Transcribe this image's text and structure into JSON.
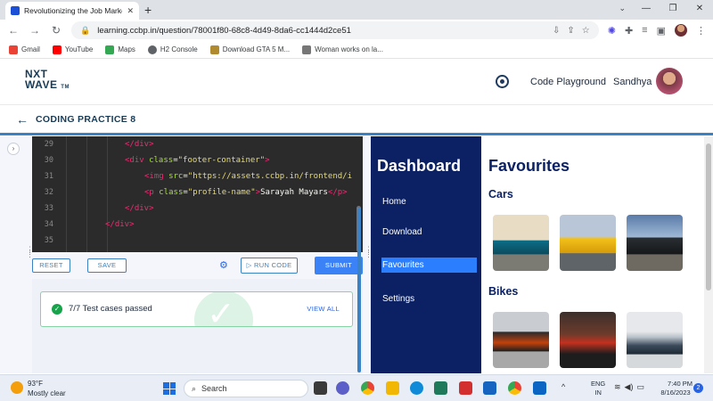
{
  "browser": {
    "tab_title": "Revolutionizing the Job Market | N",
    "url": "learning.ccbp.in/question/78001f80-68c8-4d49-8da6-cc1444d2ce51",
    "bookmarks": [
      {
        "label": "Gmail",
        "color": "#ea4335"
      },
      {
        "label": "YouTube",
        "color": "#ff0000"
      },
      {
        "label": "Maps",
        "color": "#34a853"
      },
      {
        "label": "H2 Console",
        "color": "#5f6368"
      },
      {
        "label": "Download GTA 5 M...",
        "color": "#b08a2e"
      },
      {
        "label": "Woman works on la...",
        "color": "#777777"
      }
    ]
  },
  "header": {
    "logo_line1": "NXT",
    "logo_line2": "WAVE",
    "logo_tm": "TM",
    "playground_label": "Code Playground",
    "username": "Sandhya"
  },
  "subheader": {
    "title": "CODING PRACTICE 8"
  },
  "editor": {
    "lines": [
      {
        "num": "29",
        "indent": 2,
        "tokens": [
          {
            "t": "tag",
            "v": "</div>"
          }
        ]
      },
      {
        "num": "30",
        "indent": 2,
        "tokens": [
          {
            "t": "tag",
            "v": "<div "
          },
          {
            "t": "attr",
            "v": "class"
          },
          {
            "t": "plain",
            "v": "="
          },
          {
            "t": "str",
            "v": "\"footer-container\""
          },
          {
            "t": "tag",
            "v": ">"
          }
        ]
      },
      {
        "num": "31",
        "indent": 3,
        "tokens": [
          {
            "t": "tag",
            "v": "<img "
          },
          {
            "t": "attr",
            "v": "src"
          },
          {
            "t": "plain",
            "v": "="
          },
          {
            "t": "str",
            "v": "\"https://assets.ccbp.in/frontend/i"
          }
        ]
      },
      {
        "num": "32",
        "indent": 3,
        "tokens": [
          {
            "t": "tag",
            "v": "<p "
          },
          {
            "t": "attr",
            "v": "class"
          },
          {
            "t": "plain",
            "v": "="
          },
          {
            "t": "str",
            "v": "\"profile-name\""
          },
          {
            "t": "tag",
            "v": ">"
          },
          {
            "t": "plain",
            "v": "Sarayah Mayars"
          },
          {
            "t": "tag",
            "v": "</p>"
          }
        ]
      },
      {
        "num": "33",
        "indent": 2,
        "tokens": [
          {
            "t": "tag",
            "v": "</div>"
          }
        ]
      },
      {
        "num": "34",
        "indent": 1,
        "tokens": [
          {
            "t": "tag",
            "v": "</div>"
          }
        ]
      },
      {
        "num": "35",
        "indent": 0,
        "tokens": []
      }
    ]
  },
  "actions": {
    "reset": "RESET",
    "save": "SAVE",
    "run_code": "RUN CODE",
    "submit": "SUBMIT"
  },
  "results": {
    "summary": "7/7 Test cases passed",
    "view_all": "VIEW ALL"
  },
  "preview": {
    "sidebar_title": "Dashboard",
    "nav": [
      "Home",
      "Download",
      "Favourites",
      "Settings"
    ],
    "active_nav": "Favourites",
    "page_title": "Favourites",
    "sections": [
      "Cars",
      "Bikes"
    ]
  },
  "taskbar": {
    "temperature": "93°F",
    "weather": "Mostly clear",
    "search_placeholder": "Search",
    "lang_line1": "ENG",
    "lang_line2": "IN",
    "time": "7:40 PM",
    "date": "8/16/2023",
    "notification_count": "2"
  }
}
